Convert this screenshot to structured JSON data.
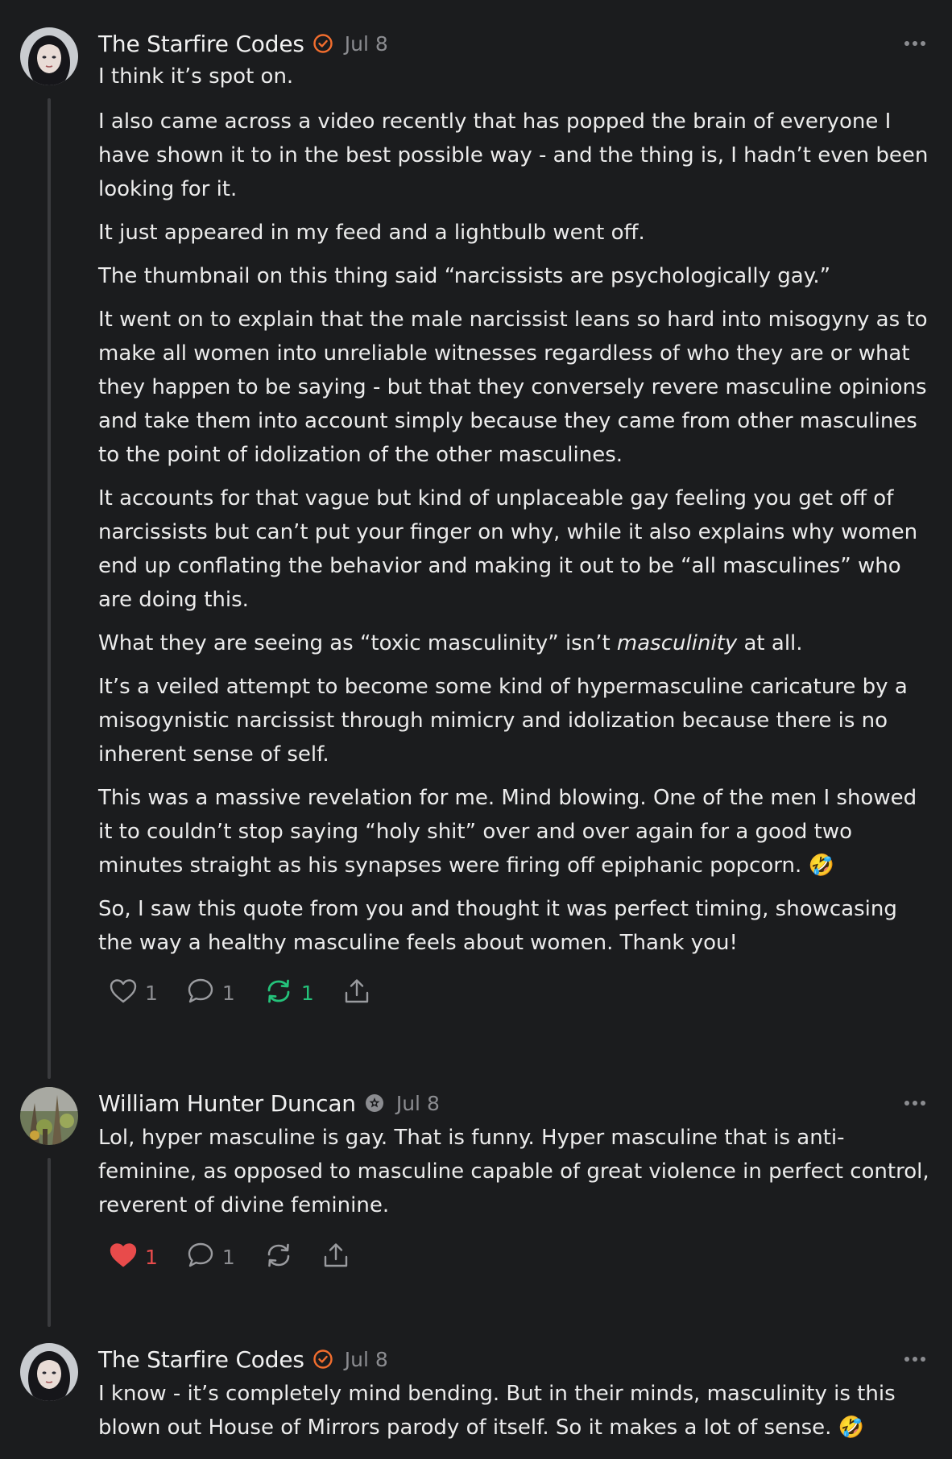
{
  "colors": {
    "background": "#1b1c1e",
    "text": "#ececec",
    "muted": "#8b8c90",
    "verified_orange": "#f36e2e",
    "restack_green": "#24c27a",
    "like_red": "#e84b4b"
  },
  "comments": [
    {
      "author": "The Starfire Codes",
      "badge_icon": "verified-check-icon",
      "date": "Jul 8",
      "paragraphs": [
        "I think it’s spot on.",
        "I also came across a video recently that has popped the brain of everyone I have shown it to in the best possible way - and the thing is, I hadn’t even been looking for it.",
        "It just appeared in my feed and a lightbulb went off.",
        "The thumbnail on this thing said “narcissists are psychologically gay.”",
        "It went on to explain that the male narcissist leans so hard into misogyny as to make all women into unreliable witnesses regardless of who they are or what they happen to be saying - but that they conversely revere masculine opinions and take them into account simply because they came from other masculines to the point of idolization of the other masculines.",
        "It accounts for that vague but kind of unplaceable gay feeling you get off of narcissists but can’t put your finger on why, while it also explains why women end up conflating the behavior and making it out to be “all masculines” who are doing this.",
        {
          "pre": "What they are seeing as “toxic masculinity” isn’t ",
          "em": "masculinity",
          "post": " at all."
        },
        "It’s a veiled attempt to become some kind of hypermasculine caricature by a misogynistic narcissist through mimicry and idolization because there is no inherent sense of self.",
        "This was a massive revelation for me. Mind blowing. One of the men I showed it to couldn’t stop saying “holy shit” over and over again for a good two minutes straight as his synapses were firing off epiphanic popcorn. 🤣",
        "So, I saw this quote from you and thought it was perfect timing, showcasing the way a healthy masculine feels about women. Thank you!"
      ],
      "actions": {
        "likes": "1",
        "comments": "1",
        "restacks": "1",
        "liked": false,
        "restacked": true
      }
    },
    {
      "author": "William Hunter Duncan",
      "badge_icon": "flower-badge-icon",
      "date": "Jul 8",
      "paragraphs": [
        "Lol, hyper masculine is gay. That is funny. Hyper masculine that is anti-feminine, as opposed to masculine capable of great violence in perfect control, reverent of divine feminine."
      ],
      "actions": {
        "likes": "1",
        "comments": "1",
        "restacks": "",
        "liked": true,
        "restacked": false
      }
    },
    {
      "author": "The Starfire Codes",
      "badge_icon": "verified-check-icon",
      "date": "Jul 8",
      "paragraphs": [
        "I know - it’s completely mind bending. But in their minds, masculinity is this blown out House of Mirrors parody of itself. So it makes a lot of sense. 🤣"
      ]
    }
  ]
}
